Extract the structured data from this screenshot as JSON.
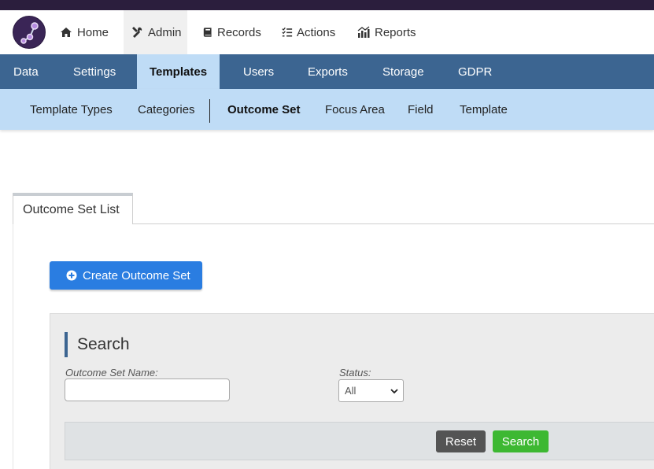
{
  "nav_primary": [
    {
      "label": "Home",
      "icon": "home-icon"
    },
    {
      "label": "Admin",
      "icon": "tools-icon",
      "active": true
    },
    {
      "label": "Records",
      "icon": "book-icon"
    },
    {
      "label": "Actions",
      "icon": "checklist-icon"
    },
    {
      "label": "Reports",
      "icon": "chart-icon"
    }
  ],
  "nav_admin": [
    {
      "label": "Data"
    },
    {
      "label": "Settings"
    },
    {
      "label": "Templates",
      "active": true
    },
    {
      "label": "Users"
    },
    {
      "label": "Exports"
    },
    {
      "label": "Storage"
    },
    {
      "label": "GDPR"
    }
  ],
  "nav_templates": [
    {
      "label": "Template Types"
    },
    {
      "label": "Categories"
    },
    {
      "label": "Outcome Set",
      "active": true
    },
    {
      "label": "Focus Area"
    },
    {
      "label": "Field"
    },
    {
      "label": "Template"
    }
  ],
  "tab": {
    "label": "Outcome Set List"
  },
  "create_button": {
    "label": "Create Outcome Set",
    "icon": "plus-circle-icon"
  },
  "search": {
    "heading": "Search",
    "name_label": "Outcome Set Name:",
    "name_value": "",
    "status_label": "Status:",
    "status_selected": "All",
    "reset_label": "Reset",
    "search_label": "Search"
  },
  "colors": {
    "topbar": "#2b1e3d",
    "admin_nav": "#3c6591",
    "sub_nav": "#bfdcf6",
    "primary_button": "#2a7de1",
    "search_button": "#3db832",
    "reset_button": "#545454"
  }
}
